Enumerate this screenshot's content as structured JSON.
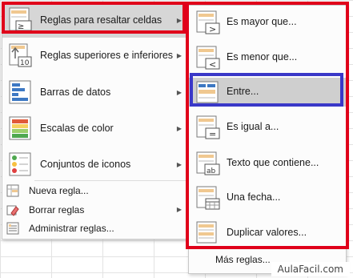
{
  "main_menu": {
    "items": [
      {
        "label": "Reglas para resaltar celdas",
        "icon": "highlight-rules-icon"
      },
      {
        "label": "Reglas superiores e inferiores",
        "icon": "top-bottom-rules-icon"
      },
      {
        "label": "Barras de datos",
        "icon": "data-bars-icon"
      },
      {
        "label": "Escalas de color",
        "icon": "color-scales-icon"
      },
      {
        "label": "Conjuntos de iconos",
        "icon": "icon-sets-icon"
      },
      {
        "label": "Nueva regla...",
        "icon": "new-rule-icon"
      },
      {
        "label": "Borrar reglas",
        "icon": "clear-rules-icon"
      },
      {
        "label": "Administrar reglas...",
        "icon": "manage-rules-icon"
      }
    ]
  },
  "submenu": {
    "items": [
      {
        "label": "Es mayor que...",
        "icon": "greater-than-icon"
      },
      {
        "label": "Es menor que...",
        "icon": "less-than-icon"
      },
      {
        "label": "Entre...",
        "icon": "between-icon"
      },
      {
        "label": "Es igual a...",
        "icon": "equal-to-icon"
      },
      {
        "label": "Texto que contiene...",
        "icon": "text-contains-icon"
      },
      {
        "label": "Una fecha...",
        "icon": "date-occurring-icon"
      },
      {
        "label": "Duplicar valores...",
        "icon": "duplicate-values-icon"
      }
    ],
    "more_rules": "Más reglas..."
  },
  "watermark": "AulaFacil.com",
  "colors": {
    "highlight_box": "#e0001a",
    "selected_box": "#3a38c8",
    "hover_bg": "#d6d6d6"
  }
}
